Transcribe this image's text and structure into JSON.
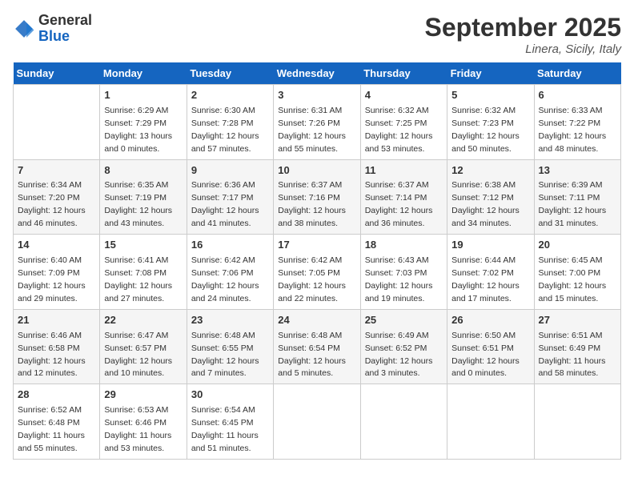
{
  "header": {
    "title": "September 2025",
    "location": "Linera, Sicily, Italy",
    "logo_general": "General",
    "logo_blue": "Blue"
  },
  "calendar": {
    "days_of_week": [
      "Sunday",
      "Monday",
      "Tuesday",
      "Wednesday",
      "Thursday",
      "Friday",
      "Saturday"
    ],
    "weeks": [
      [
        {
          "day": "",
          "info": ""
        },
        {
          "day": "1",
          "info": "Sunrise: 6:29 AM\nSunset: 7:29 PM\nDaylight: 13 hours\nand 0 minutes."
        },
        {
          "day": "2",
          "info": "Sunrise: 6:30 AM\nSunset: 7:28 PM\nDaylight: 12 hours\nand 57 minutes."
        },
        {
          "day": "3",
          "info": "Sunrise: 6:31 AM\nSunset: 7:26 PM\nDaylight: 12 hours\nand 55 minutes."
        },
        {
          "day": "4",
          "info": "Sunrise: 6:32 AM\nSunset: 7:25 PM\nDaylight: 12 hours\nand 53 minutes."
        },
        {
          "day": "5",
          "info": "Sunrise: 6:32 AM\nSunset: 7:23 PM\nDaylight: 12 hours\nand 50 minutes."
        },
        {
          "day": "6",
          "info": "Sunrise: 6:33 AM\nSunset: 7:22 PM\nDaylight: 12 hours\nand 48 minutes."
        }
      ],
      [
        {
          "day": "7",
          "info": "Sunrise: 6:34 AM\nSunset: 7:20 PM\nDaylight: 12 hours\nand 46 minutes."
        },
        {
          "day": "8",
          "info": "Sunrise: 6:35 AM\nSunset: 7:19 PM\nDaylight: 12 hours\nand 43 minutes."
        },
        {
          "day": "9",
          "info": "Sunrise: 6:36 AM\nSunset: 7:17 PM\nDaylight: 12 hours\nand 41 minutes."
        },
        {
          "day": "10",
          "info": "Sunrise: 6:37 AM\nSunset: 7:16 PM\nDaylight: 12 hours\nand 38 minutes."
        },
        {
          "day": "11",
          "info": "Sunrise: 6:37 AM\nSunset: 7:14 PM\nDaylight: 12 hours\nand 36 minutes."
        },
        {
          "day": "12",
          "info": "Sunrise: 6:38 AM\nSunset: 7:12 PM\nDaylight: 12 hours\nand 34 minutes."
        },
        {
          "day": "13",
          "info": "Sunrise: 6:39 AM\nSunset: 7:11 PM\nDaylight: 12 hours\nand 31 minutes."
        }
      ],
      [
        {
          "day": "14",
          "info": "Sunrise: 6:40 AM\nSunset: 7:09 PM\nDaylight: 12 hours\nand 29 minutes."
        },
        {
          "day": "15",
          "info": "Sunrise: 6:41 AM\nSunset: 7:08 PM\nDaylight: 12 hours\nand 27 minutes."
        },
        {
          "day": "16",
          "info": "Sunrise: 6:42 AM\nSunset: 7:06 PM\nDaylight: 12 hours\nand 24 minutes."
        },
        {
          "day": "17",
          "info": "Sunrise: 6:42 AM\nSunset: 7:05 PM\nDaylight: 12 hours\nand 22 minutes."
        },
        {
          "day": "18",
          "info": "Sunrise: 6:43 AM\nSunset: 7:03 PM\nDaylight: 12 hours\nand 19 minutes."
        },
        {
          "day": "19",
          "info": "Sunrise: 6:44 AM\nSunset: 7:02 PM\nDaylight: 12 hours\nand 17 minutes."
        },
        {
          "day": "20",
          "info": "Sunrise: 6:45 AM\nSunset: 7:00 PM\nDaylight: 12 hours\nand 15 minutes."
        }
      ],
      [
        {
          "day": "21",
          "info": "Sunrise: 6:46 AM\nSunset: 6:58 PM\nDaylight: 12 hours\nand 12 minutes."
        },
        {
          "day": "22",
          "info": "Sunrise: 6:47 AM\nSunset: 6:57 PM\nDaylight: 12 hours\nand 10 minutes."
        },
        {
          "day": "23",
          "info": "Sunrise: 6:48 AM\nSunset: 6:55 PM\nDaylight: 12 hours\nand 7 minutes."
        },
        {
          "day": "24",
          "info": "Sunrise: 6:48 AM\nSunset: 6:54 PM\nDaylight: 12 hours\nand 5 minutes."
        },
        {
          "day": "25",
          "info": "Sunrise: 6:49 AM\nSunset: 6:52 PM\nDaylight: 12 hours\nand 3 minutes."
        },
        {
          "day": "26",
          "info": "Sunrise: 6:50 AM\nSunset: 6:51 PM\nDaylight: 12 hours\nand 0 minutes."
        },
        {
          "day": "27",
          "info": "Sunrise: 6:51 AM\nSunset: 6:49 PM\nDaylight: 11 hours\nand 58 minutes."
        }
      ],
      [
        {
          "day": "28",
          "info": "Sunrise: 6:52 AM\nSunset: 6:48 PM\nDaylight: 11 hours\nand 55 minutes."
        },
        {
          "day": "29",
          "info": "Sunrise: 6:53 AM\nSunset: 6:46 PM\nDaylight: 11 hours\nand 53 minutes."
        },
        {
          "day": "30",
          "info": "Sunrise: 6:54 AM\nSunset: 6:45 PM\nDaylight: 11 hours\nand 51 minutes."
        },
        {
          "day": "",
          "info": ""
        },
        {
          "day": "",
          "info": ""
        },
        {
          "day": "",
          "info": ""
        },
        {
          "day": "",
          "info": ""
        }
      ]
    ]
  }
}
